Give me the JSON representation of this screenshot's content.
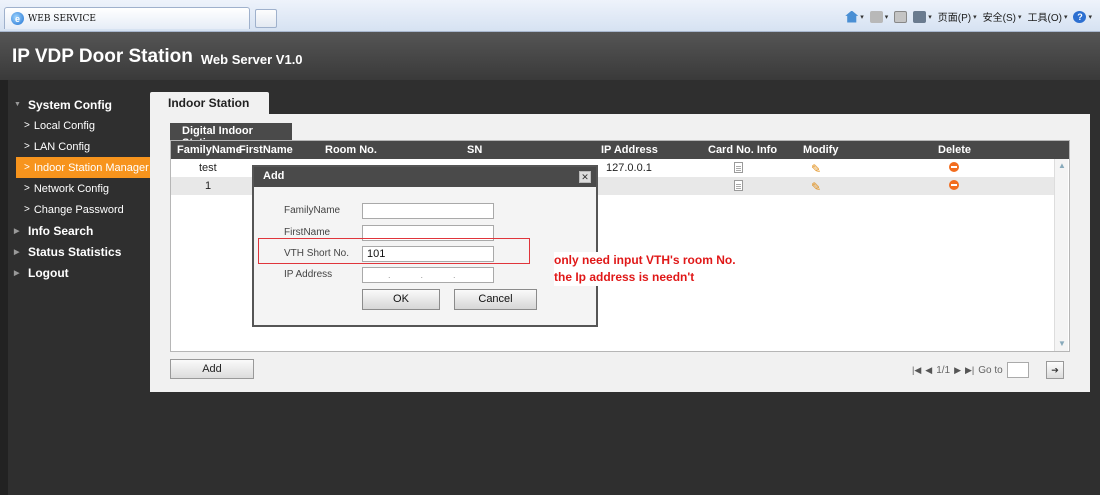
{
  "browser": {
    "tab_title": "WEB SERVICE",
    "tools": {
      "page_menu": "页面(P)",
      "safety_menu": "安全(S)",
      "tools_menu": "工具(O)"
    }
  },
  "header": {
    "title": "IP VDP Door Station",
    "subtitle": "Web Server V1.0"
  },
  "sidebar": {
    "system_config": "System Config",
    "items": [
      "Local Config",
      "LAN Config",
      "Indoor Station Manager",
      "Network Config",
      "Change Password"
    ],
    "info_search": "Info Search",
    "status_statistics": "Status Statistics",
    "logout": "Logout"
  },
  "main": {
    "tab": "Indoor Station",
    "sub_tab": "Digital Indoor Station",
    "columns": [
      "FamilyName",
      "FirstName",
      "Room No.",
      "SN",
      "IP Address",
      "Card No. Info",
      "Modify",
      "Delete"
    ],
    "rows": [
      {
        "family": "test",
        "ip": "127.0.0.1"
      },
      {
        "family": "1",
        "ip": ""
      }
    ],
    "add_button": "Add",
    "pager": {
      "page": "1/1",
      "goto_label": "Go to"
    }
  },
  "modal": {
    "title": "Add",
    "family_label": "FamilyName",
    "first_label": "FirstName",
    "vth_label": "VTH Short No.",
    "vth_value": "101",
    "ip_label": "IP Address",
    "ok": "OK",
    "cancel": "Cancel"
  },
  "annotation": {
    "line1": "only need input VTH's room No.",
    "line2": "the Ip address is needn't"
  },
  "colors": {
    "accent_orange": "#f7941d",
    "annotation_red": "#e01818",
    "header_dark": "#484848"
  }
}
